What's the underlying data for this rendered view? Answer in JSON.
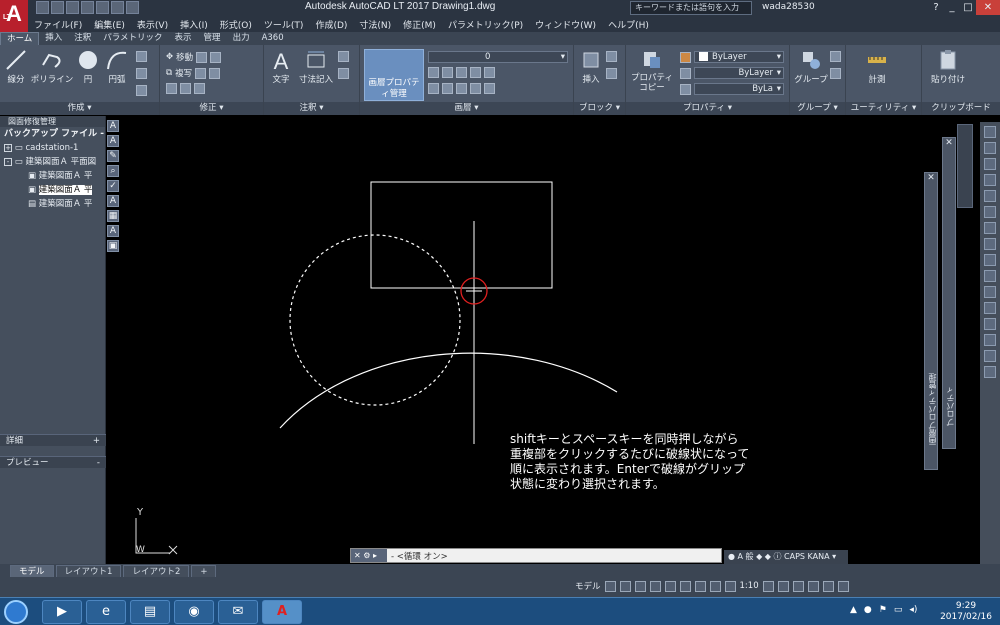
{
  "titlebar": {
    "app_title": "Autodesk AutoCAD LT 2017    Drawing1.dwg",
    "search_placeholder": "キーワードまたは語句を入力",
    "user": "wada28530",
    "logo": "A",
    "logo_sub": "LT"
  },
  "menubar": {
    "items": [
      "ファイル(F)",
      "編集(E)",
      "表示(V)",
      "挿入(I)",
      "形式(O)",
      "ツール(T)",
      "作成(D)",
      "寸法(N)",
      "修正(M)",
      "パラメトリック(P)",
      "ウィンドウ(W)",
      "ヘルプ(H)"
    ]
  },
  "ribbon_tabs": {
    "items": [
      "ホーム",
      "挿入",
      "注釈",
      "パラメトリック",
      "表示",
      "管理",
      "出力",
      "A360"
    ],
    "active": "ホーム"
  },
  "ribbon": {
    "draw": {
      "title": "作成 ▾",
      "line": "線分",
      "polyline": "ポリライン",
      "circle": "円",
      "arc": "円弧"
    },
    "modify": {
      "title": "修正 ▾",
      "move": "移動",
      "copy": "複写"
    },
    "annotation": {
      "title": "注釈 ▾",
      "text": "文字",
      "dimension": "寸法記入"
    },
    "layers": {
      "title": "画層 ▾",
      "layer_props": "画層プロパティ管理",
      "layer_value": "0"
    },
    "block": {
      "title": "ブロック ▾",
      "insert": "挿入"
    },
    "properties": {
      "title": "プロパティ ▾",
      "match": "プロパティコピー",
      "color": "ByLayer",
      "linetype": "ByLayer",
      "lineweight": "ByLa"
    },
    "groups": {
      "title": "グループ ▾",
      "group": "グループ"
    },
    "utilities": {
      "title": "ユーティリティ ▾",
      "measure": "計測"
    },
    "clipboard": {
      "title": "クリップボード",
      "paste": "貼り付け"
    }
  },
  "left_palette": {
    "title": "図面修復管理",
    "header": "バックアップ ファイル -",
    "tree": [
      {
        "label": "cadstation-1",
        "indent": 0,
        "box": "+"
      },
      {
        "label": "建築図面Ａ  平面図",
        "indent": 0,
        "box": "-"
      },
      {
        "label": "建築図面Ａ  平",
        "indent": 1,
        "box": ""
      },
      {
        "label": "建築図面Ａ  平",
        "indent": 1,
        "box": "",
        "selected": true
      },
      {
        "label": "建築図面Ａ  平",
        "indent": 1,
        "box": ""
      }
    ],
    "details": "詳細",
    "details_toggle": "+",
    "preview": "プレビュー",
    "preview_toggle": "-"
  },
  "canvas": {
    "callout_lines": [
      "shiftキーとスペースキーを同時押しながら",
      "重複部をクリックするたびに破線状になって",
      "順に表示されます。Enterで破線がグリップ",
      "状態に変わり選択されます。"
    ],
    "ucs_y": "Y",
    "ucs_w": "W"
  },
  "right_panels": {
    "layer_props": "画層プロパティ管理",
    "properties": "プロパティ"
  },
  "command_line": {
    "text": "- <循環 オン>"
  },
  "layout_tabs": {
    "items": [
      "モデル",
      "レイアウト1",
      "レイアウト2",
      "+"
    ],
    "active": "モデル"
  },
  "statusbar": {
    "model": "モデル",
    "scale": "1:10"
  },
  "taskbar": {
    "time": "9:29",
    "date": "2017/02/16"
  },
  "colors": {
    "accent_red": "#e02020",
    "canvas_bg": "#000000",
    "ribbon_bg": "#4b5667",
    "taskbar_bg": "#1c4d7e"
  }
}
